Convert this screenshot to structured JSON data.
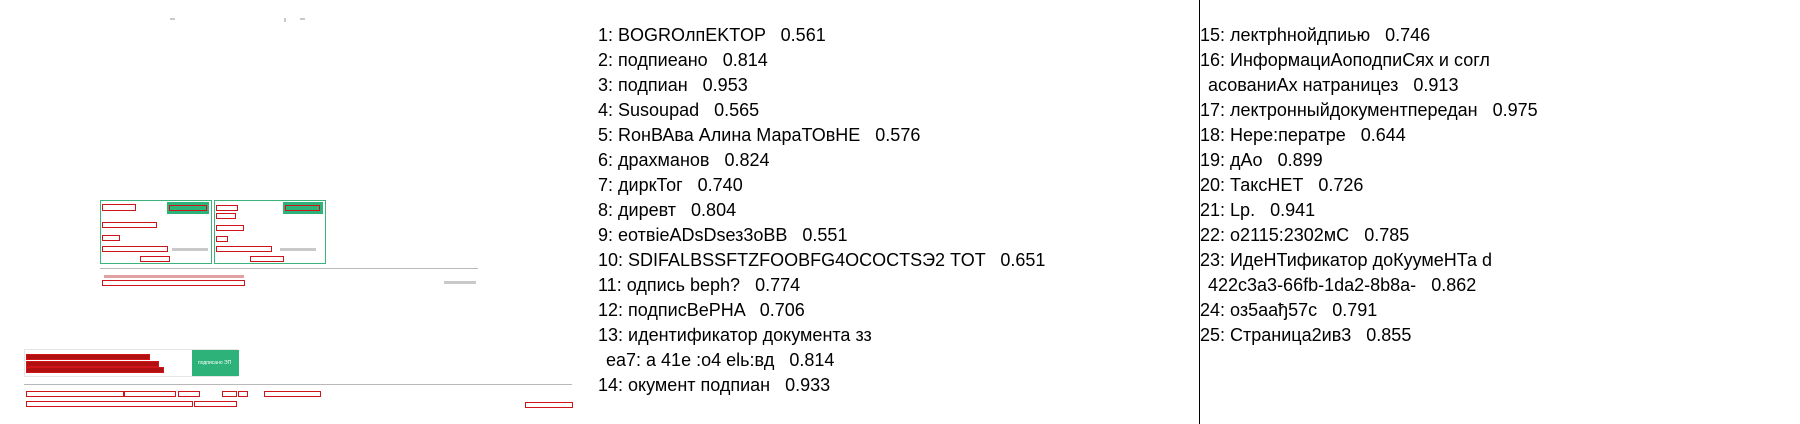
{
  "document_preview": {
    "stamp_button_label": "подписано ЭП"
  },
  "ocr_results_left": [
    {
      "num": "1",
      "text": "BOGROлпEKTOP",
      "score": "0.561"
    },
    {
      "num": "2",
      "text": "подпиеано",
      "score": "0.814"
    },
    {
      "num": "3",
      "text": "подпиан",
      "score": "0.953"
    },
    {
      "num": "4",
      "text": "Susoupad",
      "score": "0.565"
    },
    {
      "num": "5",
      "text": "RонВАва Алина МараТОвНЕ",
      "score": "0.576"
    },
    {
      "num": "6",
      "text": "драхманов",
      "score": "0.824"
    },
    {
      "num": "7",
      "text": "диркТог",
      "score": "0.740"
    },
    {
      "num": "8",
      "text": "диревт",
      "score": "0.804"
    },
    {
      "num": "9",
      "text": "еотвieADsDsез3оBB",
      "score": "0.551"
    },
    {
      "num": "10",
      "text": "SDIFALBSSFTZFOOBFG4OCOCTSЭ2 TOT",
      "score": "0.651"
    },
    {
      "num": "11",
      "text": "одпись beph?",
      "score": "0.774"
    },
    {
      "num": "12",
      "text": "подписВеPHA",
      "score": "0.706"
    },
    {
      "num": "13",
      "text": "идентификатор документа зз",
      "text2": "ea7: а 41е :о4 elь:вд",
      "score": "0.814"
    },
    {
      "num": "14",
      "text": "окумент подпиан",
      "score": "0.933"
    }
  ],
  "ocr_results_right": [
    {
      "num": "15",
      "text": "лектрhнойдпиью",
      "score": "0.746"
    },
    {
      "num": "16",
      "text": "ИнформациАоподпиСях и согл",
      "text2": "асованиAх натраницез",
      "score": "0.913"
    },
    {
      "num": "17",
      "text": "лектронныйдокументпередан",
      "score": "0.975"
    },
    {
      "num": "18",
      "text": "Нере:ператре",
      "score": "0.644"
    },
    {
      "num": "19",
      "text": "дАо",
      "score": "0.899"
    },
    {
      "num": "20",
      "text": "ТаксНЕТ",
      "score": "0.726"
    },
    {
      "num": "21",
      "text": "Lp.",
      "score": "0.941"
    },
    {
      "num": "22",
      "text": "о2115:2302мС",
      "score": "0.785"
    },
    {
      "num": "23",
      "text": "ИдеНТификатор доКуумеНТа d",
      "text2": "422c3a3-66fb-1da2-8b8a-",
      "score": "0.862"
    },
    {
      "num": "24",
      "text": "оз5аађ57с",
      "score": "0.791"
    },
    {
      "num": "25",
      "text": "Страница2ив3",
      "score": "0.855"
    }
  ]
}
